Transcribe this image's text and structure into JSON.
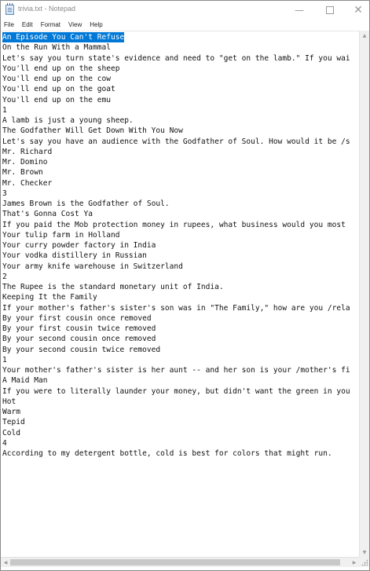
{
  "window": {
    "title": "trivia.txt - Notepad",
    "icon": "notepad-icon",
    "controls": {
      "minimize": "—",
      "close": "✕"
    }
  },
  "menu": [
    "File",
    "Edit",
    "Format",
    "View",
    "Help"
  ],
  "editor": {
    "selected_text": "An Episode You Can't Refuse",
    "lines": [
      "An Episode You Can't Refuse",
      "On the Run With a Mammal",
      "Let's say you turn state's evidence and need to \"get on the lamb.\" If you wai",
      "You'll end up on the sheep",
      "You'll end up on the cow",
      "You'll end up on the goat",
      "You'll end up on the emu",
      "1",
      "A lamb is just a young sheep.",
      "The Godfather Will Get Down With You Now",
      "Let's say you have an audience with the Godfather of Soul. How would it be /s",
      "Mr. Richard",
      "Mr. Domino",
      "Mr. Brown",
      "Mr. Checker",
      "3",
      "James Brown is the Godfather of Soul.",
      "That's Gonna Cost Ya",
      "If you paid the Mob protection money in rupees, what business would you most",
      "Your tulip farm in Holland",
      "Your curry powder factory in India",
      "Your vodka distillery in Russian",
      "Your army knife warehouse in Switzerland",
      "2",
      "The Rupee is the standard monetary unit of India.",
      "Keeping It the Family",
      "If your mother's father's sister's son was in \"The Family,\" how are you /rela",
      "By your first cousin once removed",
      "By your first cousin twice removed",
      "By your second cousin once removed",
      "By your second cousin twice removed",
      "1",
      "Your mother's father's sister is her aunt -- and her son is your /mother's fi",
      "A Maid Man",
      "If you were to literally launder your money, but didn't want the green in you",
      "Hot",
      "Warm",
      "Tepid",
      "Cold",
      "4",
      "According to my detergent bottle, cold is best for colors that might run."
    ]
  },
  "colors": {
    "selection": "#0078d7",
    "text": "#111111",
    "title_text": "#8a8a8a"
  }
}
